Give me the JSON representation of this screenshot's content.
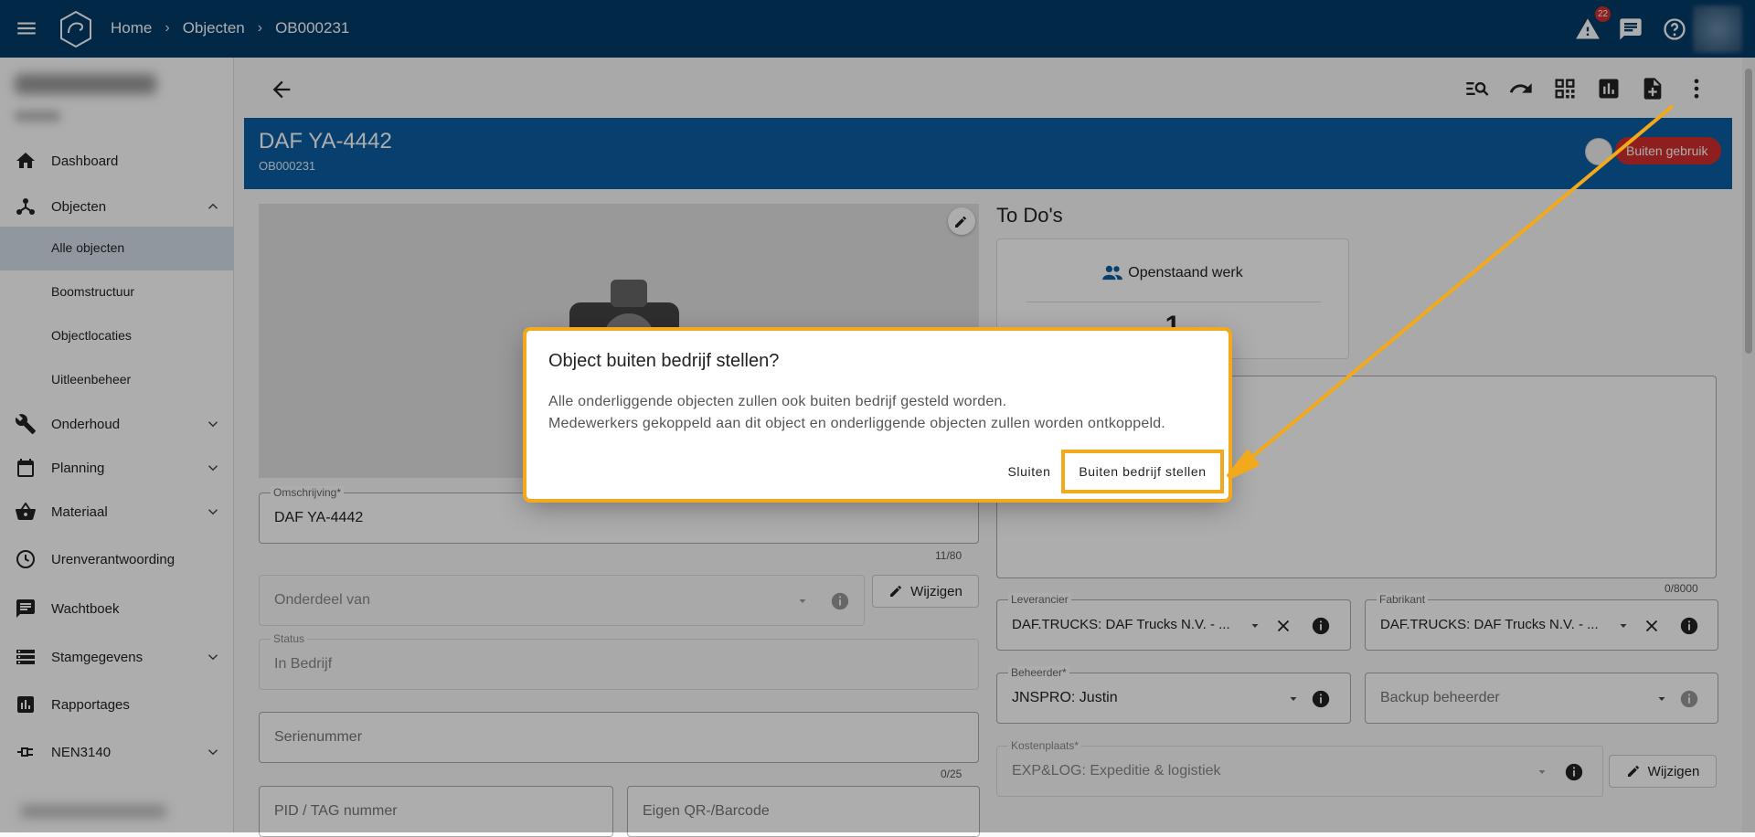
{
  "topbar": {
    "breadcrumbs": [
      "Home",
      "Objecten",
      "OB000231"
    ],
    "notification_count": "22",
    "icons": [
      "menu-icon",
      "warning-icon",
      "chat-icon",
      "help-icon"
    ]
  },
  "sidebar": {
    "items": [
      {
        "label": "Dashboard",
        "icon": "home-icon"
      },
      {
        "label": "Objecten",
        "icon": "hub-icon",
        "expanded": true
      },
      {
        "label": "Onderhoud",
        "icon": "wrench-icon"
      },
      {
        "label": "Planning",
        "icon": "calendar-icon"
      },
      {
        "label": "Materiaal",
        "icon": "basket-icon"
      },
      {
        "label": "Urenverantwoording",
        "icon": "clock-icon"
      },
      {
        "label": "Wachtboek",
        "icon": "message-icon"
      },
      {
        "label": "Stamgegevens",
        "icon": "storage-icon"
      },
      {
        "label": "Rapportages",
        "icon": "chart-icon"
      },
      {
        "label": "NEN3140",
        "icon": "plug-icon"
      }
    ],
    "sub_items": [
      "Alle objecten",
      "Boomstructuur",
      "Objectlocaties",
      "Uitleenbeheer"
    ],
    "active_sub": "Alle objecten"
  },
  "object": {
    "title": "DAF YA-4442",
    "code": "OB000231",
    "status_chip": "Buiten gebruik"
  },
  "form": {
    "omschrijving_label": "Omschrijving*",
    "omschrijving_value": "DAF YA-4442",
    "omschrijving_counter": "11/80",
    "onderdeel_placeholder": "Onderdeel van",
    "wijzigen_label": "Wijzigen",
    "status_label": "Status",
    "status_value": "In Bedrijf",
    "serienummer_placeholder": "Serienummer",
    "serienummer_counter": "0/25",
    "pid_placeholder": "PID / TAG nummer",
    "qr_placeholder": "Eigen QR-/Barcode",
    "leverancier_label": "Leverancier",
    "leverancier_value": "DAF.TRUCKS: DAF Trucks N.V. - ...",
    "fabrikant_label": "Fabrikant",
    "fabrikant_value": "DAF.TRUCKS: DAF Trucks N.V. - ...",
    "beheerder_label": "Beheerder*",
    "beheerder_value": "JNSPRO: Justin",
    "backup_placeholder": "Backup beheerder",
    "kostenplaats_label": "Kostenplaats*",
    "kostenplaats_value": "EXP&LOG: Expeditie & logistiek",
    "kostenplaats_wijzigen": "Wijzigen",
    "textarea_counter": "0/8000"
  },
  "todo": {
    "title": "To Do's",
    "card_label": "Openstaand werk",
    "card_count": "1"
  },
  "dialog": {
    "title": "Object buiten bedrijf stellen?",
    "line1": "Alle onderliggende objecten zullen ook buiten bedrijf gesteld worden.",
    "line2": "Medewerkers gekoppeld aan dit object en onderliggende objecten zullen worden ontkoppeld.",
    "close_label": "Sluiten",
    "confirm_label": "Buiten bedrijf stellen"
  },
  "colors": {
    "topbar": "#043b6b",
    "header": "#0b5fa3",
    "status_red": "#d32f2f",
    "highlight": "#f2a91c"
  }
}
